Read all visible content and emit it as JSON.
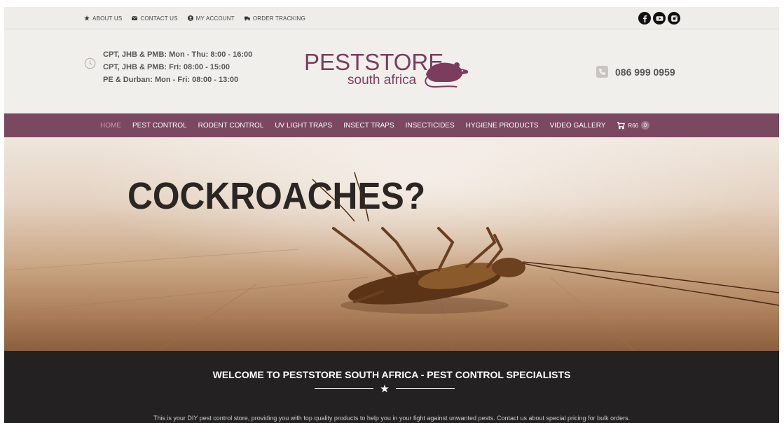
{
  "topbar": {
    "links": [
      {
        "label": "ABOUT US",
        "icon": "star-icon"
      },
      {
        "label": "CONTACT US",
        "icon": "envelope-icon"
      },
      {
        "label": "MY ACCOUNT",
        "icon": "user-icon"
      },
      {
        "label": "ORDER TRACKING",
        "icon": "truck-icon"
      }
    ],
    "social": [
      "facebook-icon",
      "youtube-icon",
      "instagram-icon"
    ]
  },
  "header": {
    "hours": [
      "CPT, JHB & PMB: Mon - Thu: 8:00 - 16:00",
      "CPT, JHB & PMB: Fri: 08:00 - 15:00",
      "PE & Durban: Mon - Fri: 08:00 - 13:00"
    ],
    "logo_line1": "PESTSTORE",
    "logo_line2": "south africa",
    "phone": "086 999 0959"
  },
  "nav": {
    "items": [
      {
        "label": "HOME",
        "active": true
      },
      {
        "label": "PEST CONTROL"
      },
      {
        "label": "RODENT CONTROL"
      },
      {
        "label": "UV LIGHT TRAPS"
      },
      {
        "label": "INSECT TRAPS"
      },
      {
        "label": "INSECTICIDES"
      },
      {
        "label": "HYGIENE PRODUCTS"
      },
      {
        "label": "VIDEO GALLERY"
      }
    ],
    "cart_total": "R66",
    "cart_count": "0"
  },
  "hero": {
    "title": "COCKROACHES?"
  },
  "welcome": {
    "title": "WELCOME TO PESTSTORE SOUTH AFRICA - PEST CONTROL SPECIALISTS",
    "text": "This is your DIY pest control store, providing you with top quality products to help you in your fight against unwanted pests. Contact us about special pricing for bulk orders."
  },
  "colors": {
    "brand": "#7a4861",
    "logo": "#7b3c5d",
    "dark_section": "#232121"
  }
}
